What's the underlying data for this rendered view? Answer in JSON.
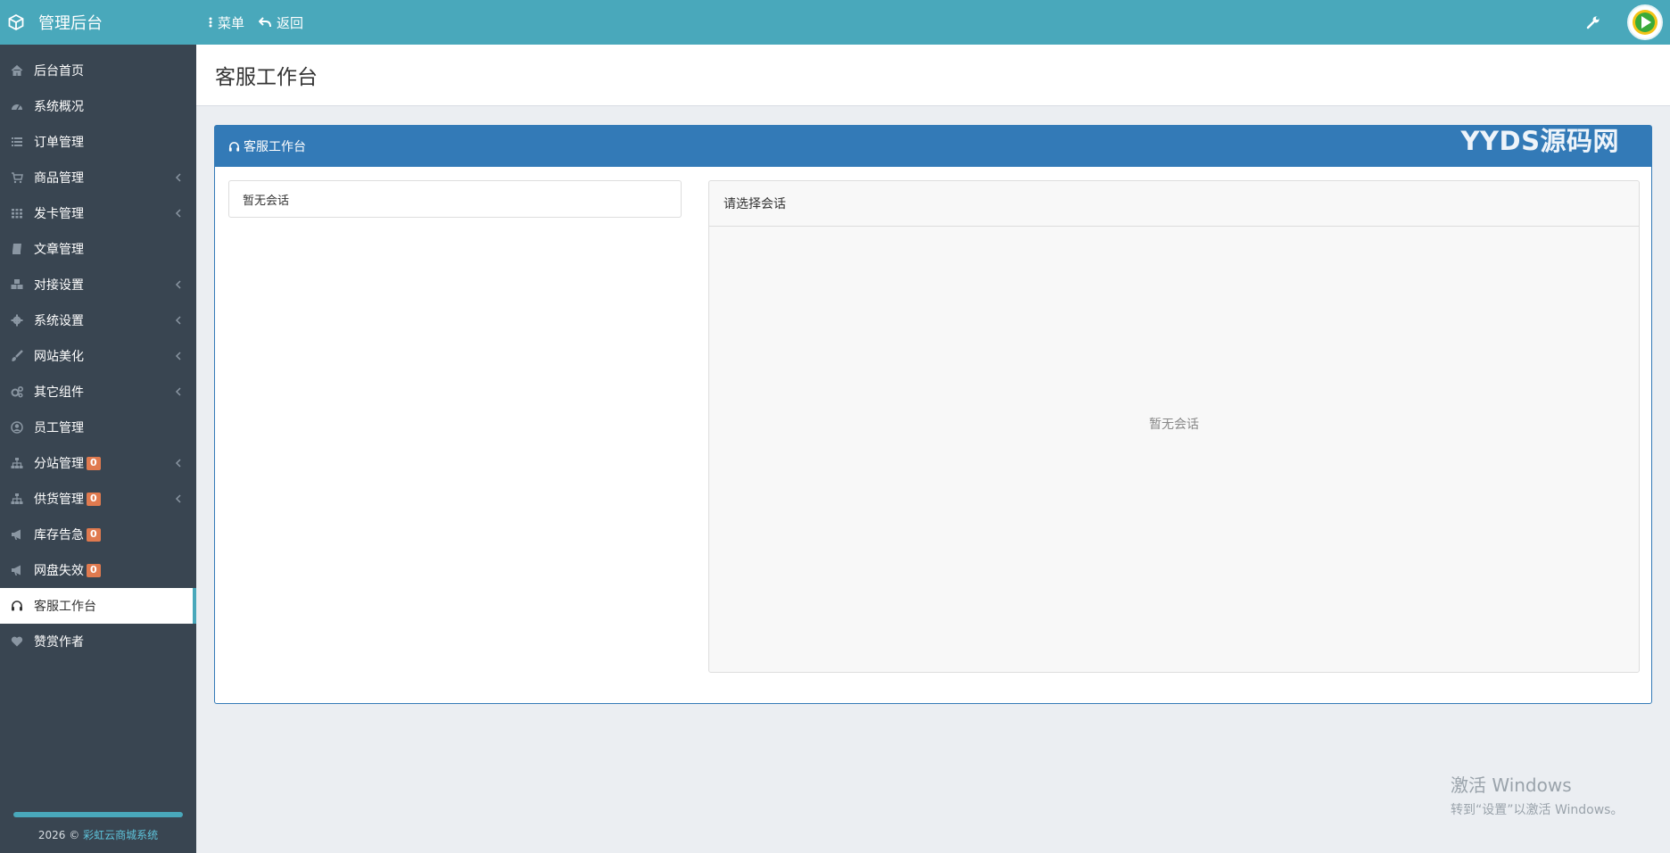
{
  "colors": {
    "topbar": "#49a8bb",
    "sidebar": "#394551",
    "panel_primary": "#337ab7",
    "badge": "#e07a4f"
  },
  "topbar": {
    "brand": "管理后台",
    "menu_label": "菜单",
    "back_label": "返回",
    "brand_icon": "cube-icon",
    "wrench_icon": "wrench-icon"
  },
  "sidebar": {
    "items": [
      {
        "label": "后台首页",
        "icon": "home-icon"
      },
      {
        "label": "系统概况",
        "icon": "dashboard-icon"
      },
      {
        "label": "订单管理",
        "icon": "list-icon"
      },
      {
        "label": "商品管理",
        "icon": "cart-icon"
      },
      {
        "label": "发卡管理",
        "icon": "grid-icon"
      },
      {
        "label": "文章管理",
        "icon": "book-icon"
      },
      {
        "label": "对接设置",
        "icon": "cubes-icon"
      },
      {
        "label": "系统设置",
        "icon": "gear-icon"
      },
      {
        "label": "网站美化",
        "icon": "brush-icon"
      },
      {
        "label": "其它组件",
        "icon": "cogs-icon"
      },
      {
        "label": "员工管理",
        "icon": "user-circle-icon"
      },
      {
        "label": "分站管理",
        "icon": "sitemap-icon",
        "badge": "0"
      },
      {
        "label": "供货管理",
        "icon": "sitemap-icon",
        "badge": "0"
      },
      {
        "label": "库存告急",
        "icon": "bullhorn-icon",
        "badge": "0"
      },
      {
        "label": "网盘失效",
        "icon": "bullhorn-icon",
        "badge": "0"
      },
      {
        "label": "客服工作台",
        "icon": "headphones-icon"
      },
      {
        "label": "赞赏作者",
        "icon": "heart-icon"
      }
    ],
    "footer_year": "2026 ©",
    "footer_link": "彩虹云商城系统"
  },
  "page": {
    "title": "客服工作台"
  },
  "panel": {
    "heading": "客服工作台",
    "watermark": "YYDS源码网",
    "session_empty": "暂无会话",
    "chat_header": "请选择会话",
    "chat_empty": "暂无会话"
  },
  "windows": {
    "line1": "激活 Windows",
    "line2": "转到“设置”以激活 Windows。"
  }
}
